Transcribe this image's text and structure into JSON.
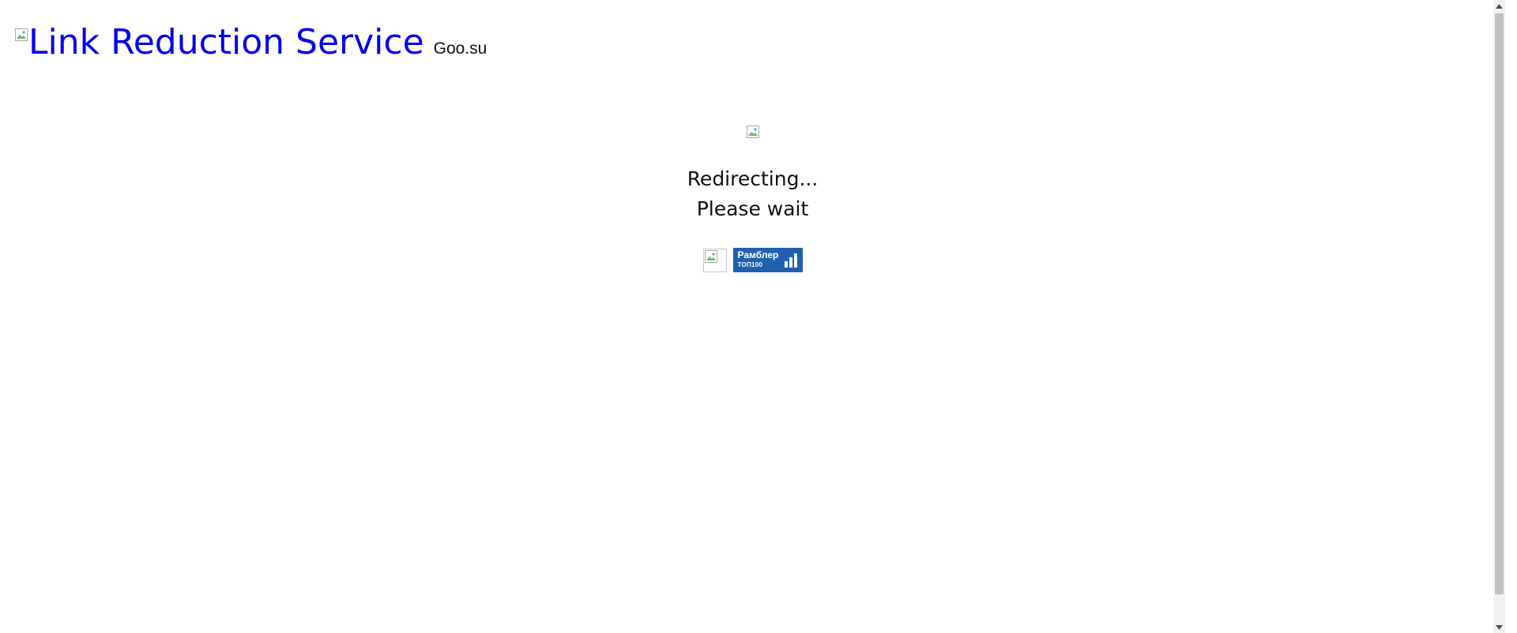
{
  "header": {
    "logo_alt_text": "Link Reduction Service",
    "site_name": "Goo.su",
    "link_color": "#0000ee"
  },
  "main": {
    "status_line_1": "Redirecting...",
    "status_line_2": "Please wait"
  },
  "counters": {
    "rambler": {
      "title": "Рамблер",
      "subtitle": "ТОП100",
      "background_color": "#1f61b0"
    }
  },
  "icons": {
    "broken_image": "broken-image-icon",
    "bar_chart": "bar-chart-icon",
    "scroll_up": "arrow-up-icon",
    "scroll_down": "arrow-down-icon"
  }
}
